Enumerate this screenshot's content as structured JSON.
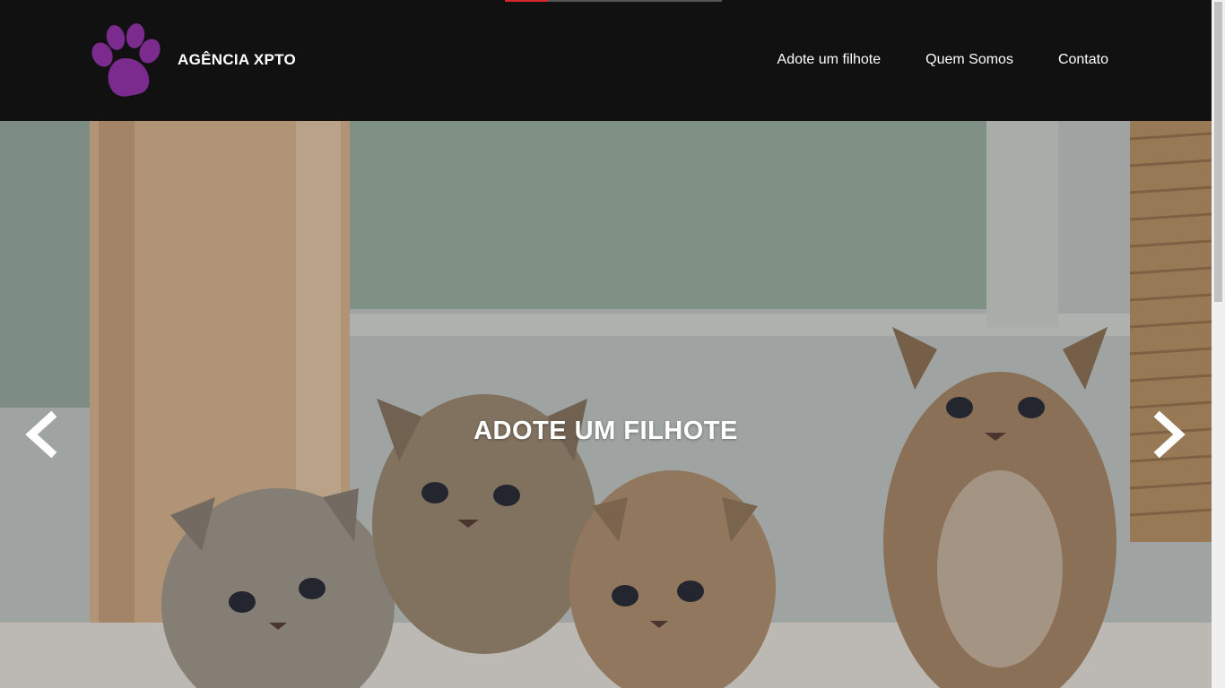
{
  "brand": {
    "name": "AGÊNCIA XPTO",
    "logo_color": "#7b2a8e"
  },
  "nav": {
    "items": [
      "Adote um filhote",
      "Quem Somos",
      "Contato"
    ]
  },
  "hero": {
    "title": "ADOTE UM FILHOTE",
    "prev_icon": "chevron-left-icon",
    "next_icon": "chevron-right-icon",
    "image": "kittens-photo",
    "slides": 2,
    "active_slide": 1
  },
  "colors": {
    "header_bg": "#111111",
    "text": "#ffffff",
    "indicator_active": "#d7262c"
  }
}
